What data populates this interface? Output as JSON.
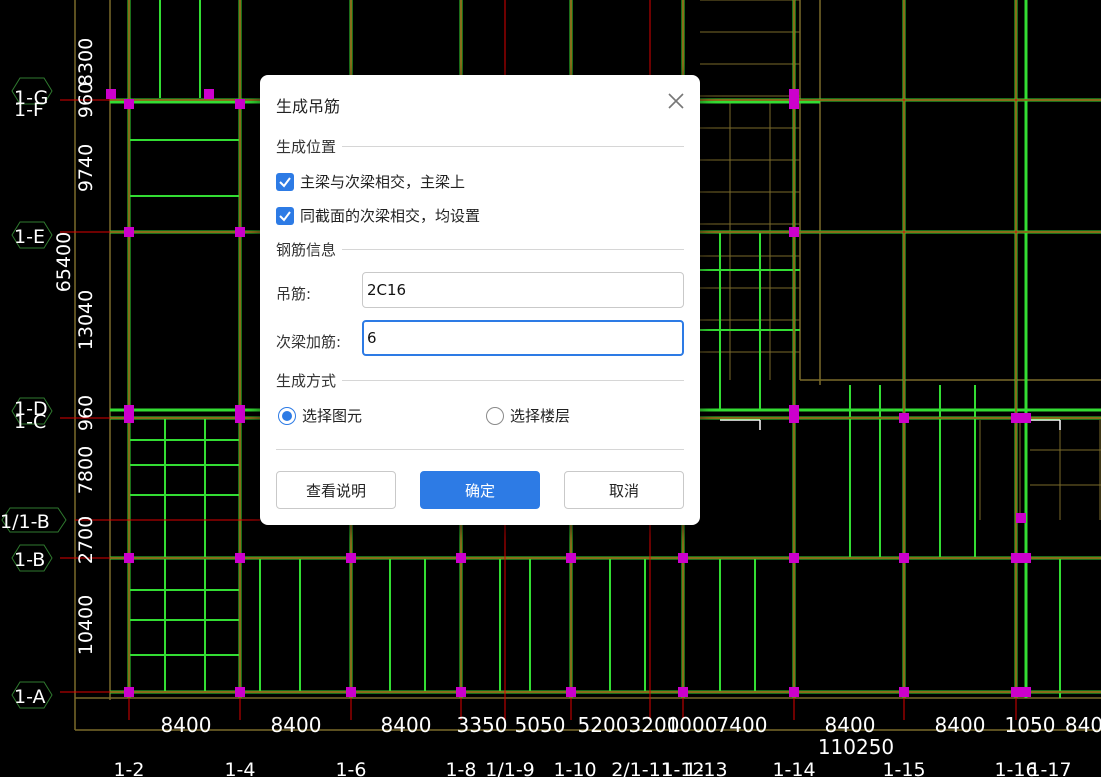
{
  "cad": {
    "row_labels": [
      "1-G",
      "1-F",
      "1-E",
      "1-D",
      "1-C",
      "1/1-B",
      "1-B",
      "1-A"
    ],
    "row_dims": [
      "8300",
      "960",
      "9740",
      "13040",
      "960",
      "7800",
      "2700",
      "10400"
    ],
    "total_height": "65400",
    "col_dims": [
      "8400",
      "8400",
      "8400",
      "3350",
      "5050",
      "5200",
      "3200",
      "1000",
      "7400",
      "8400",
      "8400",
      "1050",
      "840"
    ],
    "total_width": "110250",
    "col_labels": [
      "1-2",
      "1-4",
      "1-6",
      "1-8",
      "1/1-9",
      "1-10",
      "2/1-11",
      "1-12",
      "1-13",
      "1-14",
      "1-15",
      "1-16",
      "1-17"
    ]
  },
  "dialog": {
    "title": "生成吊筋",
    "section_position": "生成位置",
    "check1_label": "主梁与次梁相交，主梁上",
    "check2_label": "同截面的次梁相交，均设置",
    "section_rebar": "钢筋信息",
    "hanger_label": "吊筋:",
    "hanger_value": "2C16",
    "secondary_label": "次梁加筋:",
    "secondary_value": "6",
    "section_method": "生成方式",
    "radio1_label": "选择图元",
    "radio2_label": "选择楼层",
    "btn_help": "查看说明",
    "btn_ok": "确定",
    "btn_cancel": "取消"
  },
  "colors": {
    "accent": "#2d7be5",
    "beam": "#33dd33",
    "column": "#cc00cc",
    "grid": "#dd0000",
    "wall": "#7a6a2a"
  }
}
